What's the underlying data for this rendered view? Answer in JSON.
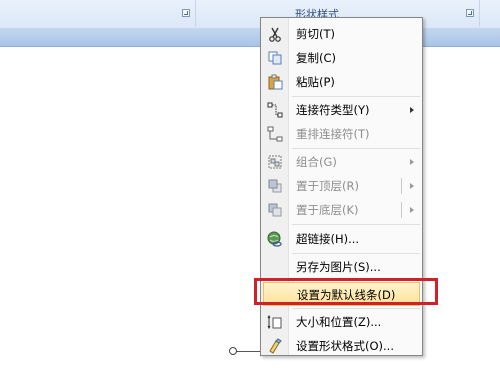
{
  "ribbon": {
    "group_label": "形状样式"
  },
  "menu": {
    "items": [
      {
        "id": "cut",
        "label": "剪切(T)",
        "icon": "scissors-icon"
      },
      {
        "id": "copy",
        "label": "复制(C)",
        "icon": "copy-icon"
      },
      {
        "id": "paste",
        "label": "粘贴(P)",
        "icon": "paste-icon"
      },
      {
        "id": "connector-type",
        "label": "连接符类型(Y)",
        "icon": "connector-icon",
        "submenu": true
      },
      {
        "id": "reroute-connectors",
        "label": "重排连接符(T)",
        "icon": "reroute-icon",
        "disabled": true
      },
      {
        "id": "group",
        "label": "组合(G)",
        "icon": "group-icon",
        "disabled": true,
        "submenu": true
      },
      {
        "id": "bring-to-front",
        "label": "置于顶层(R)",
        "icon": "bring-front-icon",
        "disabled": true,
        "submenu": true
      },
      {
        "id": "send-to-back",
        "label": "置于底层(K)",
        "icon": "send-back-icon",
        "disabled": true,
        "submenu": true
      },
      {
        "id": "hyperlink",
        "label": "超链接(H)...",
        "icon": "hyperlink-icon"
      },
      {
        "id": "save-as-picture",
        "label": "另存为图片(S)..."
      },
      {
        "id": "set-default-line",
        "label": "设置为默认线条(D)",
        "highlight": true
      },
      {
        "id": "size-position",
        "label": "大小和位置(Z)...",
        "icon": "size-position-icon"
      },
      {
        "id": "format-shape",
        "label": "设置形状格式(O)...",
        "icon": "format-shape-icon"
      }
    ]
  },
  "colors": {
    "highlight_border": "#d0202a",
    "ribbon_blue": "#a9c4e6"
  }
}
